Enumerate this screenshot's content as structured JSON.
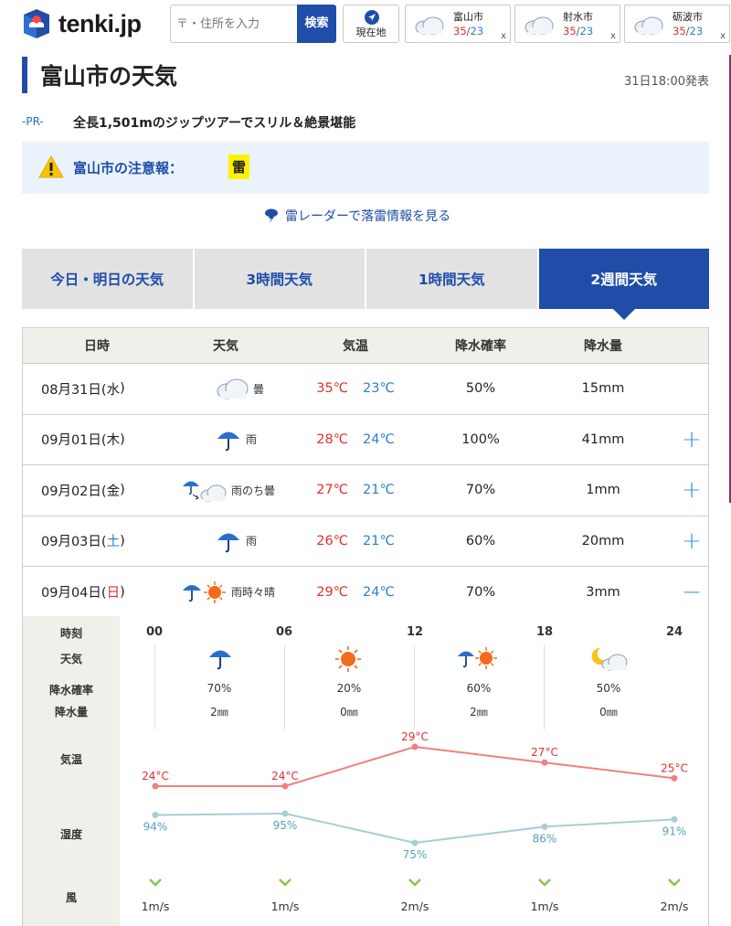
{
  "header": {
    "logo_text": "tenki.jp",
    "search_placeholder": "〒・住所を入力",
    "search_button": "検索",
    "location_button": "現在地",
    "favorites": [
      {
        "name": "富山市",
        "high": "35",
        "low": "23",
        "close": "x"
      },
      {
        "name": "射水市",
        "high": "35",
        "low": "23",
        "close": "x"
      },
      {
        "name": "砺波市",
        "high": "35",
        "low": "23",
        "close": "x"
      }
    ]
  },
  "page": {
    "title": "富山市の天気",
    "issued": "31日18:00発表",
    "pr_label": "-PR-",
    "pr_text": "全長1,501mのジップツアーでスリル＆絶景堪能",
    "alert_label": "富山市の注意報：",
    "alert_badge": "雷",
    "radar_link": "雷レーダーで落雷情報を見る"
  },
  "tabs": [
    {
      "label": "今日・明日の天気",
      "active": false
    },
    {
      "label": "3時間天気",
      "active": false
    },
    {
      "label": "1時間天気",
      "active": false
    },
    {
      "label": "2週間天気",
      "active": true
    }
  ],
  "table": {
    "headers": [
      "日時",
      "天気",
      "気温",
      "降水確率",
      "降水量"
    ],
    "rows": [
      {
        "date": "08月31日(",
        "dow": "水",
        "close": ")",
        "dow_color": "normal",
        "weather": "曇",
        "icon": "cloud-icon",
        "high": "35℃",
        "low": "23℃",
        "prob": "50%",
        "amount": "15mm",
        "expand": ""
      },
      {
        "date": "09月01日(",
        "dow": "木",
        "close": ")",
        "dow_color": "normal",
        "weather": "雨",
        "icon": "umbrella-icon",
        "high": "28℃",
        "low": "24℃",
        "prob": "100%",
        "amount": "41mm",
        "expand": "+"
      },
      {
        "date": "09月02日(",
        "dow": "金",
        "close": ")",
        "dow_color": "normal",
        "weather": "雨のち曇",
        "icon": "rain-then-cloud-icon",
        "high": "27℃",
        "low": "21℃",
        "prob": "70%",
        "amount": "1mm",
        "expand": "+"
      },
      {
        "date": "09月03日(",
        "dow": "土",
        "close": ")",
        "dow_color": "sat",
        "weather": "雨",
        "icon": "umbrella-icon",
        "high": "26℃",
        "low": "21℃",
        "prob": "60%",
        "amount": "20mm",
        "expand": "+"
      },
      {
        "date": "09月04日(",
        "dow": "日",
        "close": ")",
        "dow_color": "sun",
        "weather": "雨時々晴",
        "icon": "rain-sometimes-sun-icon",
        "high": "29℃",
        "low": "24℃",
        "prob": "70%",
        "amount": "3mm",
        "expand": "−"
      }
    ]
  },
  "detail": {
    "labels": {
      "time": "時刻",
      "weather": "天気",
      "prob": "降水確率",
      "amount": "降水量",
      "temp": "気温",
      "humidity": "湿度",
      "wind": "風"
    },
    "hours": [
      "00",
      "06",
      "12",
      "18",
      "24"
    ],
    "weather_icons": [
      "umbrella-icon",
      "sun-icon",
      "rain-sun-icon",
      "moon-cloud-icon"
    ],
    "probs": [
      "70%",
      "20%",
      "60%",
      "50%"
    ],
    "amounts": [
      "2㎜",
      "0㎜",
      "2㎜",
      "0㎜"
    ],
    "temps": [
      "24°C",
      "24°C",
      "29°C",
      "27°C",
      "25°C"
    ],
    "humidity": [
      "94%",
      "95%",
      "75%",
      "86%",
      "91%"
    ],
    "winds": [
      "1m/s",
      "1m/s",
      "2m/s",
      "1m/s",
      "2m/s"
    ]
  },
  "chart_data": {
    "type": "line",
    "x": [
      "00",
      "06",
      "12",
      "18",
      "24"
    ],
    "series": [
      {
        "name": "気温",
        "values": [
          24,
          24,
          29,
          27,
          25
        ],
        "unit": "°C",
        "color": "#f08080"
      },
      {
        "name": "湿度",
        "values": [
          94,
          95,
          75,
          86,
          91
        ],
        "unit": "%",
        "color": "#a8cdd8"
      }
    ]
  },
  "colors": {
    "brand": "#1f4da8",
    "high": "#e03030",
    "low": "#2a7fd0",
    "accent": "#3a9ae8",
    "alert_bg": "#eaf3fb",
    "badge": "#fff000"
  }
}
